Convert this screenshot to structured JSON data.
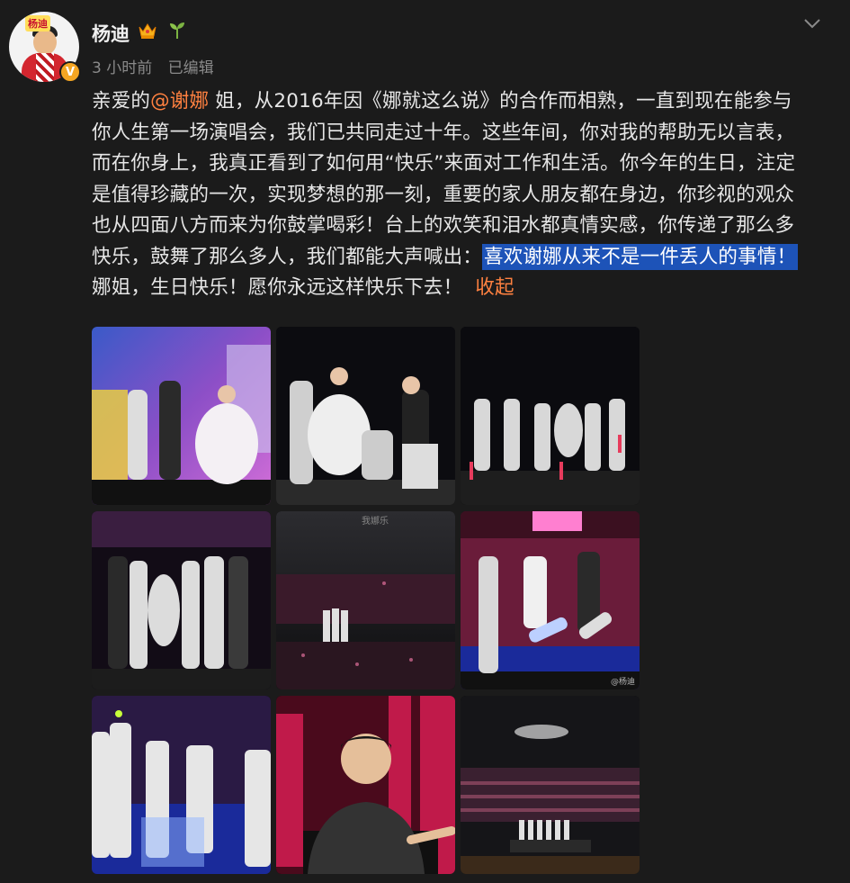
{
  "author": {
    "name": "杨迪",
    "avatar_badge_text": "杨迪",
    "verified_mark": "V"
  },
  "meta": {
    "time": "3 小时前",
    "edited": "已编辑"
  },
  "post": {
    "line1_a": "亲爱的",
    "mention": "@谢娜",
    "line1_b": " 姐，从2016年因《娜就这么说》的合作而相熟，一直到现在能参与",
    "line2": "你人生第一场演唱会，我们已共同走过十年。这些年间，你对我的帮助无以言表，",
    "line3": "而在你身上，我真正看到了如何用“快乐”来面对工作和生活。你今年的生日，注定",
    "line4": "是值得珍藏的一次，实现梦想的那一刻，重要的家人朋友都在身边，你珍视的观众",
    "line5": "也从四面八方而来为你鼓掌喝彩！台上的欢笑和泪水都真情实感，你传递了那么多",
    "line6_a": "快乐，鼓舞了那么多人，我们都能大声喊出：",
    "highlighted": "喜欢谢娜从来不是一件丢人的事情！",
    "line7": "娜姐，生日快乐！愿你永远这样快乐下去！",
    "collapse_label": "收起"
  },
  "photos": {
    "watermark": "@杨迪",
    "watermark2": "@杨迪",
    "screen_text": "我娜乐"
  },
  "icons": [
    "crown-icon",
    "sprout-icon",
    "chevron-down-icon"
  ],
  "colors": {
    "accent": "#ff8140",
    "highlight": "#1d53b8",
    "background": "#1b1b1b",
    "verified": "#f5a623"
  }
}
